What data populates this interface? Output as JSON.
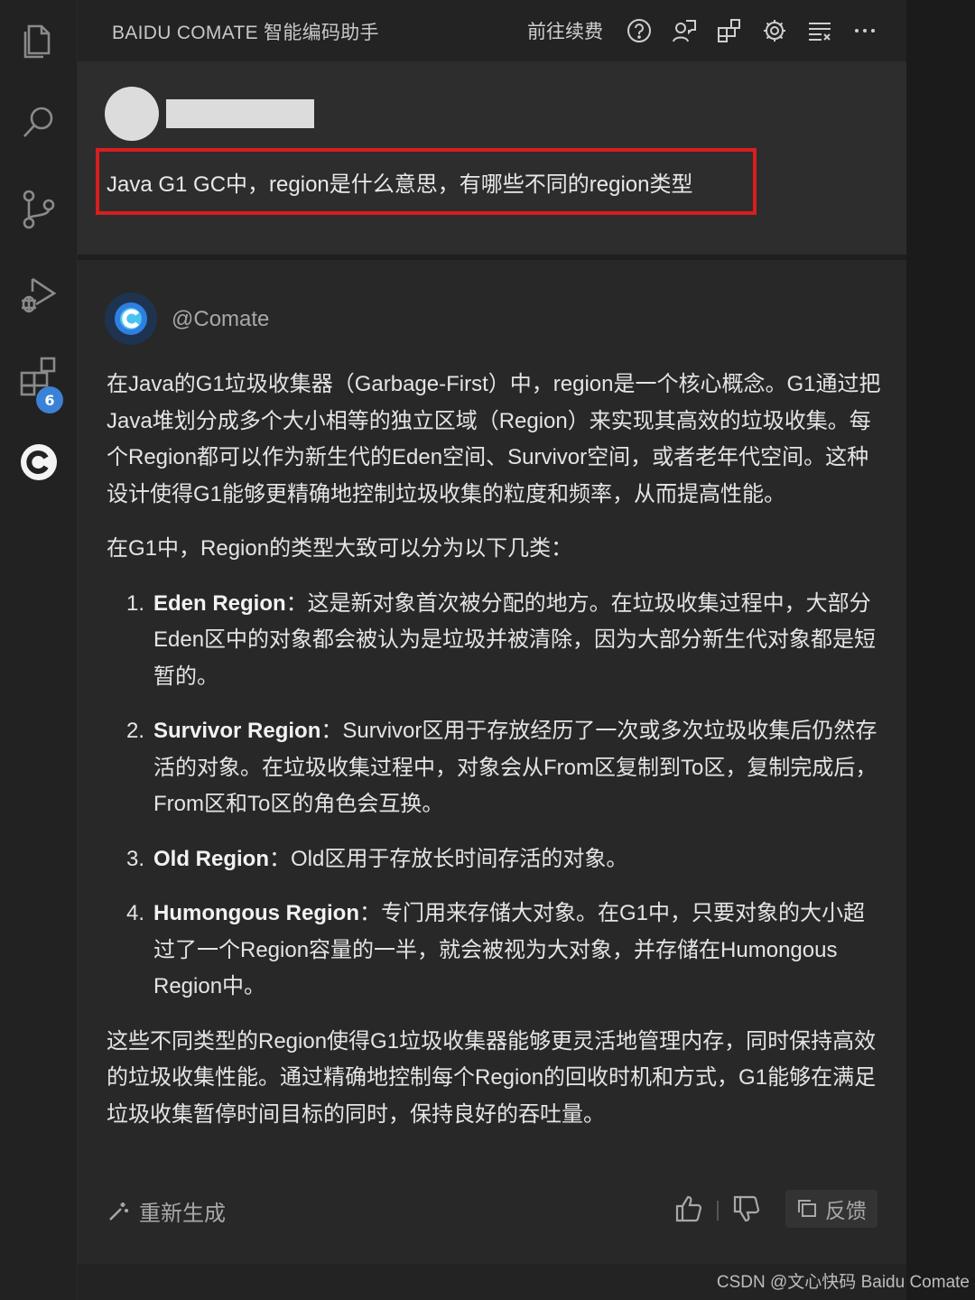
{
  "activity_bar": {
    "items": [
      {
        "icon": "files-icon"
      },
      {
        "icon": "search-icon"
      },
      {
        "icon": "source-control-icon"
      },
      {
        "icon": "run-debug-icon"
      },
      {
        "icon": "extensions-icon",
        "badge": "6"
      },
      {
        "icon": "comate-icon"
      }
    ]
  },
  "header": {
    "title": "BAIDU COMATE 智能编码助手",
    "renew_label": "前往续费",
    "icons": [
      "help-icon",
      "chat-user-icon",
      "layout-icon",
      "gear-icon",
      "list-icon",
      "more-icon"
    ]
  },
  "user_message": {
    "question": "Java G1 GC中，region是什么意思，有哪些不同的region类型"
  },
  "assistant": {
    "name": "@Comate",
    "intro": "在Java的G1垃圾收集器（Garbage-First）中，region是一个核心概念。G1通过把Java堆划分成多个大小相等的独立区域（Region）来实现其高效的垃圾收集。每个Region都可以作为新生代的Eden空间、Survivor空间，或者老年代空间。这种设计使得G1能够更精确地控制垃圾收集的粒度和频率，从而提高性能。",
    "list_intro": "在G1中，Region的类型大致可以分为以下几类：",
    "items": [
      {
        "num": "1.",
        "term": "Eden Region",
        "desc": "：这是新对象首次被分配的地方。在垃圾收集过程中，大部分Eden区中的对象都会被认为是垃圾并被清除，因为大部分新生代对象都是短暂的。"
      },
      {
        "num": "2.",
        "term": "Survivor Region",
        "desc": "：Survivor区用于存放经历了一次或多次垃圾收集后仍然存活的对象。在垃圾收集过程中，对象会从From区复制到To区，复制完成后，From区和To区的角色会互换。"
      },
      {
        "num": "3.",
        "term": "Old Region",
        "desc": "：Old区用于存放长时间存活的对象。"
      },
      {
        "num": "4.",
        "term": "Humongous Region",
        "desc": "：专门用来存储大对象。在G1中，只要对象的大小超过了一个Region容量的一半，就会被视为大对象，并存储在Humongous Region中。"
      }
    ],
    "conclusion": "这些不同类型的Region使得G1垃圾收集器能够更灵活地管理内存，同时保持高效的垃圾收集性能。通过精确地控制每个Region的回收时机和方式，G1能够在满足垃圾收集暂停时间目标的同时，保持良好的吞吐量。",
    "regenerate_label": "重新生成",
    "feedback_label": "反馈"
  },
  "watermark": "CSDN @文心快码 Baidu Comate",
  "colors": {
    "highlight_border": "#d81e1e",
    "badge": "#3b82d6",
    "bot_avatar_bg": "#1e3350"
  }
}
